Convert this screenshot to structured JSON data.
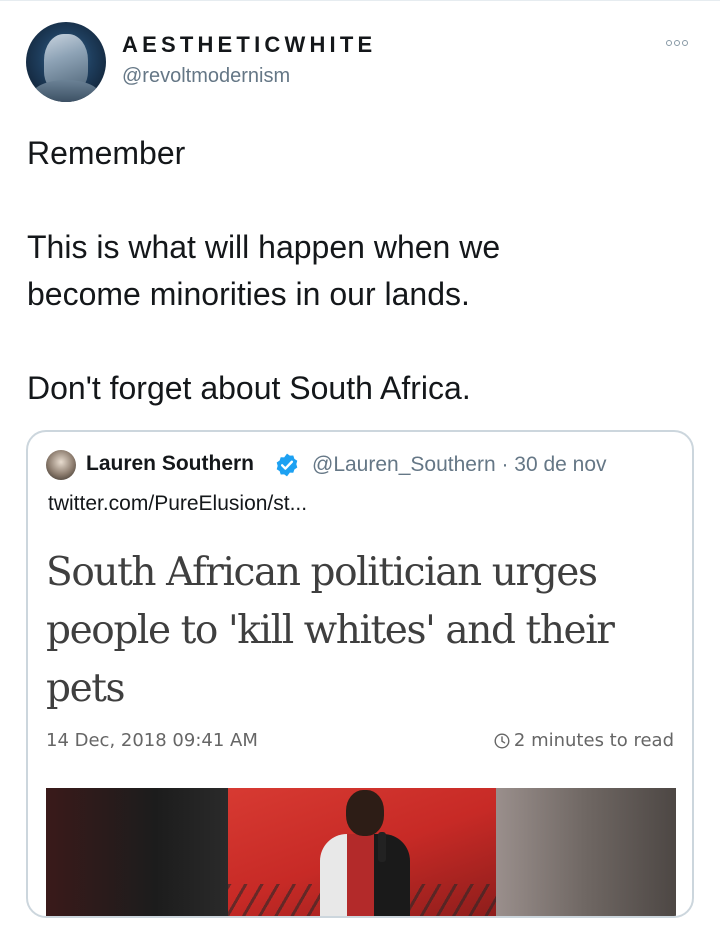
{
  "tweet": {
    "author": {
      "display_name": "AESTHETICWHITE",
      "handle": "@revoltmodernism",
      "avatar_icon": "profile-avatar"
    },
    "menu_icon": "more-options-icon",
    "text_lines": [
      "Remember",
      "",
      "This is what will happen when we",
      "become minorities in our lands.",
      "",
      "Don't forget about South Africa."
    ]
  },
  "quoted_tweet": {
    "author_name": "Lauren Southern",
    "verified_icon": "verified-badge-icon",
    "meta": "@Lauren_Southern · 30 de nov",
    "link": "twitter.com/PureElusion/st...",
    "article": {
      "headline": "South African politician urges people to 'kill whites' and their pets",
      "date": "14 Dec, 2018 09:41 AM",
      "read_time": "2 minutes to read"
    }
  },
  "colors": {
    "text_primary": "#14171a",
    "text_secondary": "#657786",
    "border": "#ccd6dd",
    "verified": "#1da1f2",
    "headline": "#3f3f3f"
  }
}
